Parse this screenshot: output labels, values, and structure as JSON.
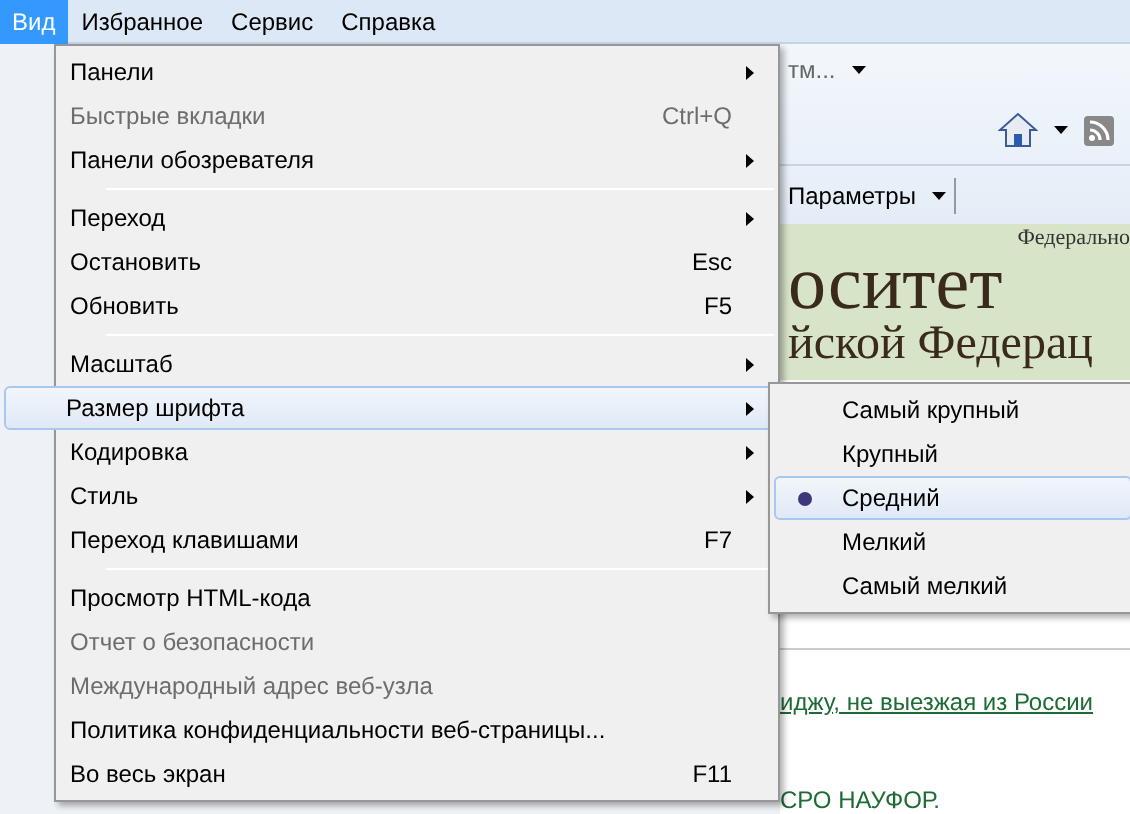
{
  "menu_bar": [
    {
      "label": "Вид",
      "selected": true
    },
    {
      "label": "Избранное",
      "selected": false
    },
    {
      "label": "Сервис",
      "selected": false
    },
    {
      "label": "Справка",
      "selected": false
    }
  ],
  "view_menu": {
    "items": [
      {
        "kind": "item",
        "label": "Панели",
        "has_submenu": true,
        "disabled": false,
        "selected": false
      },
      {
        "kind": "item",
        "label": "Быстрые вкладки",
        "shortcut": "Ctrl+Q",
        "has_submenu": false,
        "disabled": true,
        "selected": false
      },
      {
        "kind": "item",
        "label": "Панели обозревателя",
        "has_submenu": true,
        "disabled": false,
        "selected": false
      },
      {
        "kind": "separator"
      },
      {
        "kind": "item",
        "label": "Переход",
        "has_submenu": true,
        "disabled": false,
        "selected": false
      },
      {
        "kind": "item",
        "label": "Остановить",
        "shortcut": "Esc",
        "has_submenu": false,
        "disabled": false,
        "selected": false
      },
      {
        "kind": "item",
        "label": "Обновить",
        "shortcut": "F5",
        "has_submenu": false,
        "disabled": false,
        "selected": false
      },
      {
        "kind": "separator"
      },
      {
        "kind": "item",
        "label": "Масштаб",
        "has_submenu": true,
        "disabled": false,
        "selected": false
      },
      {
        "kind": "item",
        "label": "Размер шрифта",
        "has_submenu": true,
        "disabled": false,
        "selected": true
      },
      {
        "kind": "item",
        "label": "Кодировка",
        "has_submenu": true,
        "disabled": false,
        "selected": false
      },
      {
        "kind": "item",
        "label": "Стиль",
        "has_submenu": true,
        "disabled": false,
        "selected": false
      },
      {
        "kind": "item",
        "label": "Переход клавишами",
        "shortcut": "F7",
        "has_submenu": false,
        "disabled": false,
        "selected": false
      },
      {
        "kind": "separator"
      },
      {
        "kind": "item",
        "label": "Просмотр HTML-кода",
        "has_submenu": false,
        "disabled": false,
        "selected": false
      },
      {
        "kind": "item",
        "label": "Отчет о безопасности",
        "has_submenu": false,
        "disabled": true,
        "selected": false
      },
      {
        "kind": "item",
        "label": "Международный адрес веб-узла",
        "has_submenu": false,
        "disabled": true,
        "selected": false
      },
      {
        "kind": "item",
        "label": "Политика конфиденциальности веб-страницы...",
        "has_submenu": false,
        "disabled": false,
        "selected": false
      },
      {
        "kind": "item",
        "label": "Во весь экран",
        "shortcut": "F11",
        "has_submenu": false,
        "disabled": false,
        "selected": false
      }
    ]
  },
  "font_size_submenu": {
    "items": [
      {
        "label": "Самый крупный",
        "selected": false
      },
      {
        "label": "Крупный",
        "selected": false
      },
      {
        "label": "Средний",
        "selected": true
      },
      {
        "label": "Мелкий",
        "selected": false
      },
      {
        "label": "Самый мелкий",
        "selected": false
      }
    ]
  },
  "page": {
    "toolbar_text": "тм...",
    "settings_button": "Параметры",
    "header_small": "Федерально",
    "header_line_1": "оситет",
    "header_line_2": "йской Федерац",
    "link": "иджу, не выезжая из России",
    "bottom_text": "СРО НАУФОР."
  }
}
